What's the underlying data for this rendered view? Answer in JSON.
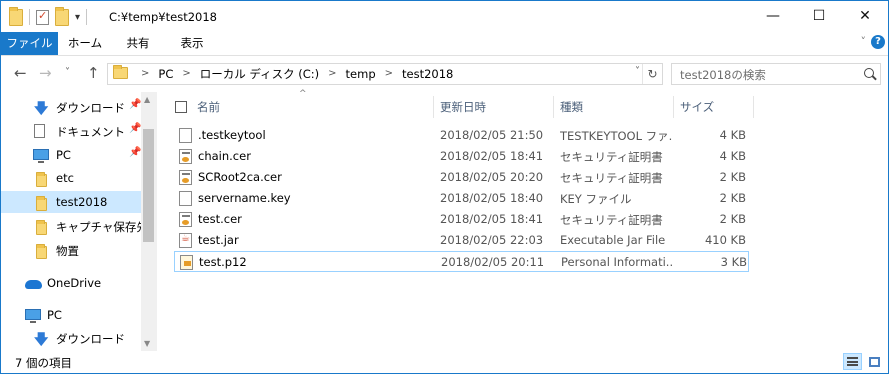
{
  "window": {
    "title": "C:¥temp¥test2018",
    "min_glyph": "—",
    "max_glyph": "☐",
    "close_glyph": "✕"
  },
  "ribbon": {
    "tabs": [
      {
        "label": "ファイル",
        "active": true
      },
      {
        "label": "ホーム"
      },
      {
        "label": "共有"
      },
      {
        "label": "表示"
      }
    ],
    "expand_glyph": "˅",
    "help_glyph": "?"
  },
  "nav": {
    "back_glyph": "←",
    "forward_glyph": "→",
    "recent_glyph": "˅",
    "up_glyph": "↑",
    "breadcrumb": [
      "PC",
      "ローカル ディスク (C:)",
      "temp",
      "test2018"
    ],
    "crumb_sep": ">",
    "addr_drop_glyph": "˅",
    "refresh_glyph": "↻",
    "search_placeholder": "test2018の検索"
  },
  "sidebar": {
    "items": [
      {
        "label": "ダウンロード",
        "icon": "download-arrow-icon",
        "pinned": true
      },
      {
        "label": "ドキュメント",
        "icon": "document-icon",
        "pinned": true
      },
      {
        "label": "PC",
        "icon": "pc-icon",
        "pinned": true
      },
      {
        "label": "etc",
        "icon": "folder-icon"
      },
      {
        "label": "test2018",
        "icon": "folder-icon",
        "selected": true
      },
      {
        "label": "キャプチャ保存先",
        "icon": "folder-icon"
      },
      {
        "label": "物置",
        "icon": "folder-icon"
      },
      {
        "label": "OneDrive",
        "icon": "onedrive-icon"
      },
      {
        "label": "PC",
        "icon": "pc-icon"
      },
      {
        "label": "ダウンロード",
        "icon": "download-arrow-icon"
      }
    ],
    "pin_glyph": "📌",
    "scroll_up_glyph": "▲",
    "scroll_down_glyph": "▼"
  },
  "filelist": {
    "columns": [
      "名前",
      "更新日時",
      "種類",
      "サイズ"
    ],
    "sort_glyph": "^",
    "rows": [
      {
        "name": ".testkeytool",
        "date": "2018/02/05 21:50",
        "type": "TESTKEYTOOL ファ...",
        "size": "4 KB",
        "icon": "plain-file-icon"
      },
      {
        "name": "chain.cer",
        "date": "2018/02/05 18:41",
        "type": "セキュリティ証明書",
        "size": "4 KB",
        "icon": "certificate-icon"
      },
      {
        "name": "SCRoot2ca.cer",
        "date": "2018/02/05 20:20",
        "type": "セキュリティ証明書",
        "size": "2 KB",
        "icon": "certificate-icon"
      },
      {
        "name": "servername.key",
        "date": "2018/02/05 18:40",
        "type": "KEY ファイル",
        "size": "2 KB",
        "icon": "plain-file-icon"
      },
      {
        "name": "test.cer",
        "date": "2018/02/05 18:41",
        "type": "セキュリティ証明書",
        "size": "2 KB",
        "icon": "certificate-icon"
      },
      {
        "name": "test.jar",
        "date": "2018/02/05 22:03",
        "type": "Executable Jar File",
        "size": "410 KB",
        "icon": "java-jar-icon"
      },
      {
        "name": "test.p12",
        "date": "2018/02/05 20:11",
        "type": "Personal Informati...",
        "size": "3 KB",
        "icon": "p12-certificate-icon",
        "focused": true
      }
    ]
  },
  "status": {
    "item_count": "7 個の項目"
  }
}
